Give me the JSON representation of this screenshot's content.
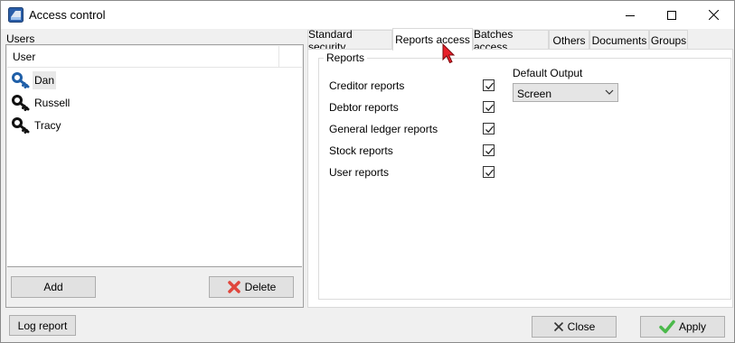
{
  "window": {
    "title": "Access control"
  },
  "users": {
    "group_label": "Users",
    "column_header": "User",
    "items": [
      {
        "name": "Dan",
        "selected": true
      },
      {
        "name": "Russell",
        "selected": false
      },
      {
        "name": "Tracy",
        "selected": false
      }
    ],
    "add_label": "Add",
    "delete_label": "Delete"
  },
  "tabs": [
    {
      "label": "Standard security",
      "active": false
    },
    {
      "label": "Reports access",
      "active": true
    },
    {
      "label": "Batches access",
      "active": false
    },
    {
      "label": "Others",
      "active": false
    },
    {
      "label": "Documents",
      "active": false
    },
    {
      "label": "Groups",
      "active": false
    }
  ],
  "reports": {
    "group_title": "Reports",
    "permissions": [
      {
        "label": "Creditor reports",
        "checked": true
      },
      {
        "label": "Debtor reports",
        "checked": true
      },
      {
        "label": "General ledger reports",
        "checked": true
      },
      {
        "label": "Stock reports",
        "checked": true
      },
      {
        "label": "User reports",
        "checked": true
      }
    ],
    "default_output_label": "Default Output",
    "default_output_value": "Screen"
  },
  "footer": {
    "log_report_label": "Log report",
    "close_label": "Close",
    "apply_label": "Apply"
  },
  "colors": {
    "delete_icon": "#e0463c",
    "apply_icon": "#4bb94b",
    "cursor": "#e8202a",
    "selected_key": "#1f5fa8"
  }
}
